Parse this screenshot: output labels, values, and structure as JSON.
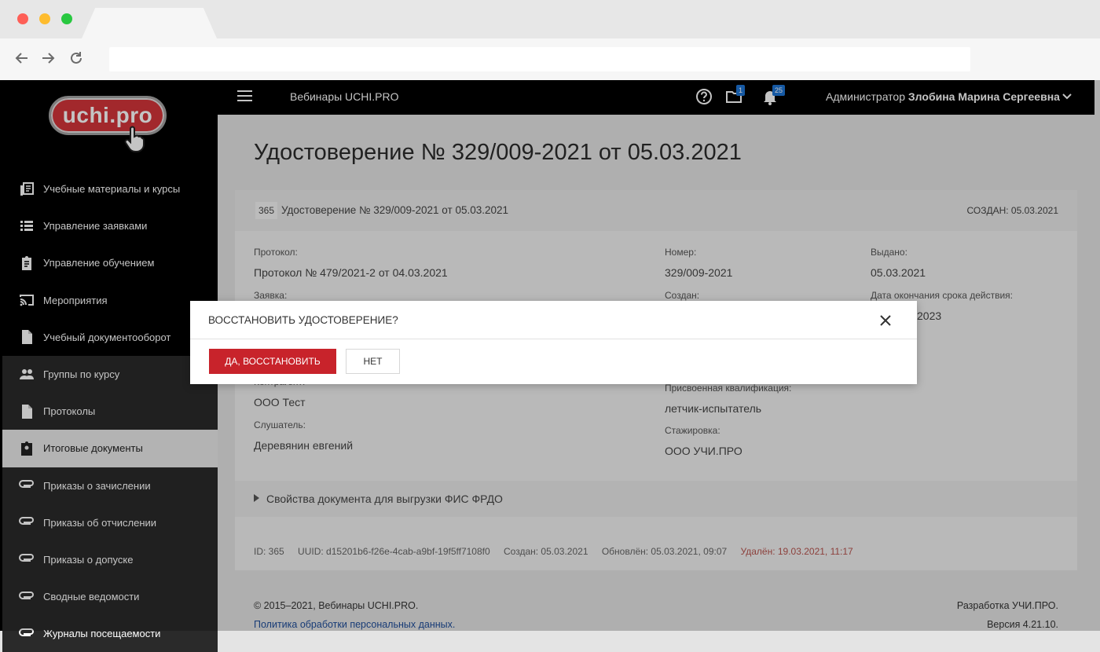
{
  "browser": {
    "address_value": ""
  },
  "app": {
    "logo_text": "uchi.pro",
    "brand_title": "Вебинары UCHI.PRO",
    "folder_badge": "1",
    "bell_badge": "25",
    "user_role": "Администратор",
    "user_name": "Злобина Марина Сергеевна"
  },
  "sidebar": {
    "items": [
      {
        "label": "Учебные материалы и курсы",
        "icon": "library-icon",
        "style": "main"
      },
      {
        "label": "Управление заявками",
        "icon": "list-icon",
        "style": "main"
      },
      {
        "label": "Управление обучением",
        "icon": "clipboard-icon",
        "style": "main"
      },
      {
        "label": "Мероприятия",
        "icon": "cast-icon",
        "style": "main"
      },
      {
        "label": "Учебный документооборот",
        "icon": "document-icon",
        "style": "main"
      },
      {
        "label": "Группы по курсу",
        "icon": "people-icon",
        "style": "sub"
      },
      {
        "label": "Протоколы",
        "icon": "document-icon",
        "style": "sub"
      },
      {
        "label": "Итоговые документы",
        "icon": "badge-icon",
        "style": "active"
      },
      {
        "label": "Приказы о зачислении",
        "icon": "paperclip-icon",
        "style": "sub"
      },
      {
        "label": "Приказы об отчислении",
        "icon": "paperclip-icon",
        "style": "sub"
      },
      {
        "label": "Приказы о допуске",
        "icon": "paperclip-icon",
        "style": "sub"
      },
      {
        "label": "Сводные ведомости",
        "icon": "paperclip-icon",
        "style": "sub"
      },
      {
        "label": "Журналы посещаемости",
        "icon": "paperclip-icon",
        "style": "sub"
      }
    ]
  },
  "page": {
    "title": "Удостоверение № 329/009-2021 от 05.03.2021",
    "card": {
      "id_chip": "365",
      "header_title": "Удостоверение № 329/009-2021 от 05.03.2021",
      "created_head": "СОЗДАН:  05.03.2021",
      "fields": {
        "protocol_label": "Протокол:",
        "protocol_value": "Протокол № 479/2021-2 от 04.03.2021",
        "number_label": "Номер:",
        "number_value": "329/009-2021",
        "issued_label": "Выдано:",
        "issued_value": "05.03.2021",
        "application_label": "Заявка:",
        "created_label": "Создан:",
        "expiry_label": "Дата окончания срока действия:",
        "expiry_value": "2023",
        "contractor_label": "Контрагент:",
        "contractor_value": "ООО Тест",
        "qualification_label": "Присвоенная квалификация:",
        "qualification_value": "летчик-испытатель",
        "student_label": "Слушатель:",
        "student_value": "Деревянин евгений",
        "internship_label": "Стажировка:",
        "internship_value": "ООО УЧИ.ПРО"
      },
      "props_label": "Свойства документа для выгрузки ФИС ФРДО",
      "meta": {
        "id": "ID:  365",
        "uuid": "UUID:  d15201b6-f26e-4cab-a9bf-19f5ff7108f0",
        "created": "Создан:  05.03.2021",
        "updated": "Обновлён:  05.03.2021, 09:07",
        "deleted": "Удалён:  19.03.2021, 11:17"
      }
    },
    "footer": {
      "copyright": "©  2015–2021, Вебинары UCHI.PRO.",
      "privacy_link": "Политика обработки персональных данных.",
      "developer": "Разработка УЧИ.ПРО.",
      "version": "Версия 4.21.10."
    }
  },
  "dialog": {
    "title": "ВОССТАНОВИТЬ УДОСТОВЕРЕНИЕ?",
    "yes_label": "ДА, ВОССТАНОВИТЬ",
    "no_label": "НЕТ"
  },
  "colors": {
    "sidebar_bg": "#000000",
    "accent_red": "#c8232b",
    "badge_blue": "#1d74d4",
    "deleted_text": "#b7544e"
  }
}
